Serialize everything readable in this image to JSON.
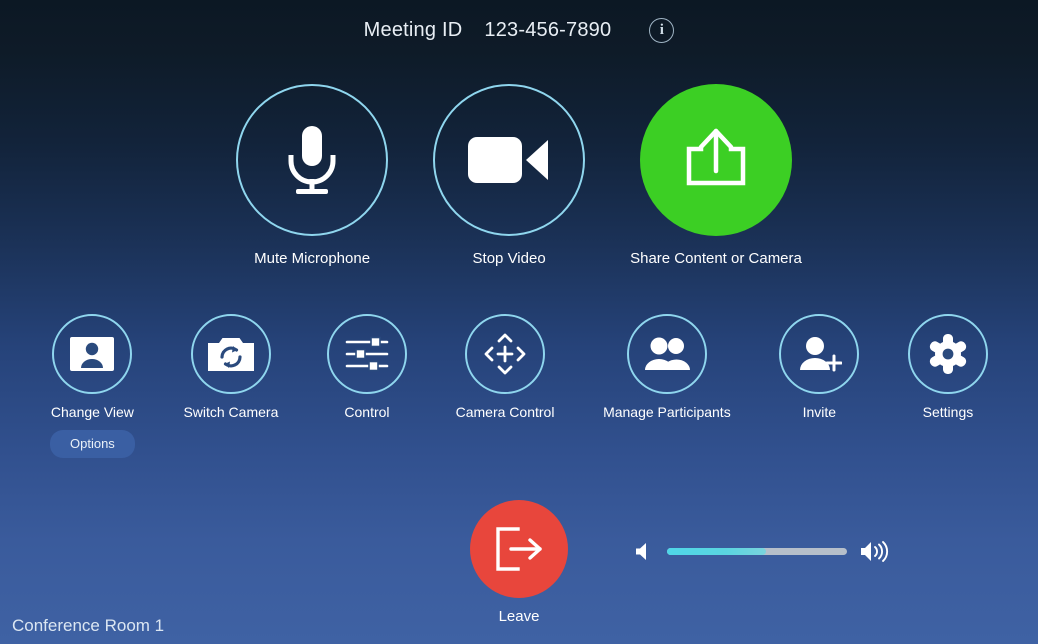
{
  "header": {
    "meeting_id_label": "Meeting ID",
    "meeting_id_value": "123-456-7890",
    "info_glyph": "i",
    "info_icon_name": "info-icon"
  },
  "primary_controls": [
    {
      "label": "Mute Microphone",
      "icon": "microphone-icon",
      "style": "outline"
    },
    {
      "label": "Stop Video",
      "icon": "video-camera-icon",
      "style": "outline"
    },
    {
      "label": "Share Content or Camera",
      "icon": "share-upload-icon",
      "style": "filled-green"
    }
  ],
  "secondary_controls": [
    {
      "label": "Change View",
      "icon": "person-card-icon"
    },
    {
      "label": "Switch Camera",
      "icon": "switch-camera-icon"
    },
    {
      "label": "Control",
      "icon": "sliders-icon"
    },
    {
      "label": "Camera Control",
      "icon": "camera-pan-tilt-icon"
    },
    {
      "label": "Manage Participants",
      "icon": "people-icon"
    },
    {
      "label": "Invite",
      "icon": "person-add-icon"
    },
    {
      "label": "Settings",
      "icon": "gear-icon"
    }
  ],
  "options_button": {
    "label": "Options"
  },
  "leave": {
    "label": "Leave",
    "icon": "exit-door-icon"
  },
  "volume": {
    "level_percent": 55,
    "mute_icon": "speaker-low-icon",
    "max_icon": "speaker-high-icon"
  },
  "footer": {
    "room_name": "Conference Room 1"
  },
  "colors": {
    "accent_cyan": "#8fd6ee",
    "share_green": "#3ccf24",
    "leave_red": "#e8463c",
    "slider_fill": "#4fd7e8",
    "slider_track": "#b6bfca",
    "bg_top": "#0c1824",
    "bg_bottom": "#3f62a4"
  }
}
